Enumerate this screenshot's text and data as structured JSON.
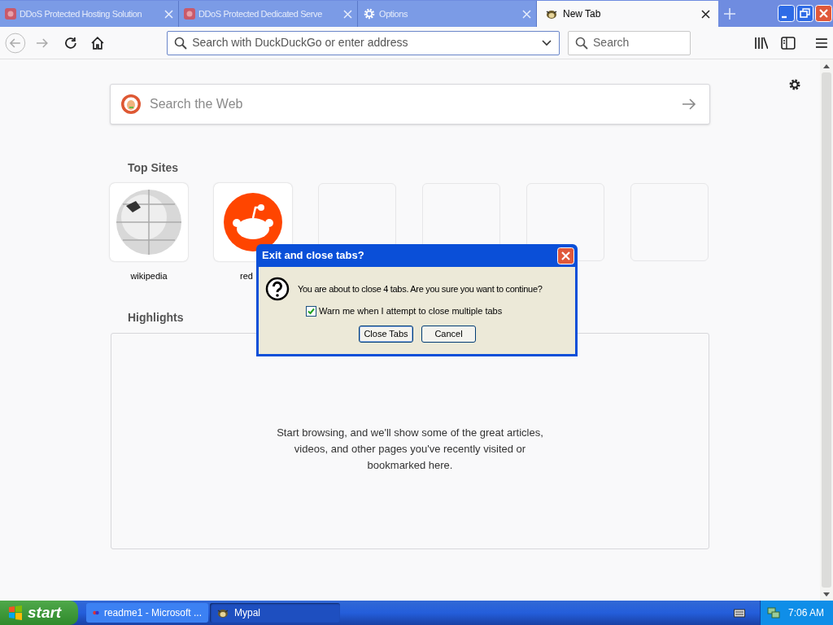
{
  "tabs": [
    {
      "label": "DDoS Protected Hosting Solution",
      "selected": false,
      "kind": "favicon"
    },
    {
      "label": "DDoS Protected Dedicated Serve",
      "selected": false,
      "kind": "favicon"
    },
    {
      "label": "Options",
      "selected": false,
      "kind": "gear"
    },
    {
      "label": "New Tab",
      "selected": true,
      "kind": "mascot"
    }
  ],
  "toolbar": {
    "address_placeholder": "Search with DuckDuckGo or enter address",
    "search_placeholder": "Search"
  },
  "page": {
    "search_placeholder": "Search the Web",
    "top_sites_title": "Top Sites",
    "top_sites": [
      {
        "kind": "wikipedia",
        "label": "wikipedia"
      },
      {
        "kind": "reddit",
        "label": "red"
      },
      {
        "kind": "empty"
      },
      {
        "kind": "empty"
      },
      {
        "kind": "empty"
      },
      {
        "kind": "empty"
      }
    ],
    "highlights_title": "Highlights",
    "highlights_message": "Start browsing, and we'll show some of the great articles, videos, and other pages you've recently visited or bookmarked here."
  },
  "dialog": {
    "title": "Exit and close tabs?",
    "message": "You are about to close 4 tabs. Are you sure you want to continue?",
    "checkbox": {
      "label": "Warn me when I attempt to close multiple tabs",
      "checked": true
    },
    "buttons": [
      {
        "label": "Close Tabs",
        "default": true
      },
      {
        "label": "Cancel",
        "default": false
      }
    ]
  },
  "taskbar": {
    "start": "start",
    "items": [
      {
        "label": "readme1 - Microsoft ...",
        "selected": false
      },
      {
        "label": "Mypal",
        "selected": true
      }
    ],
    "clock": "7:06 AM"
  }
}
